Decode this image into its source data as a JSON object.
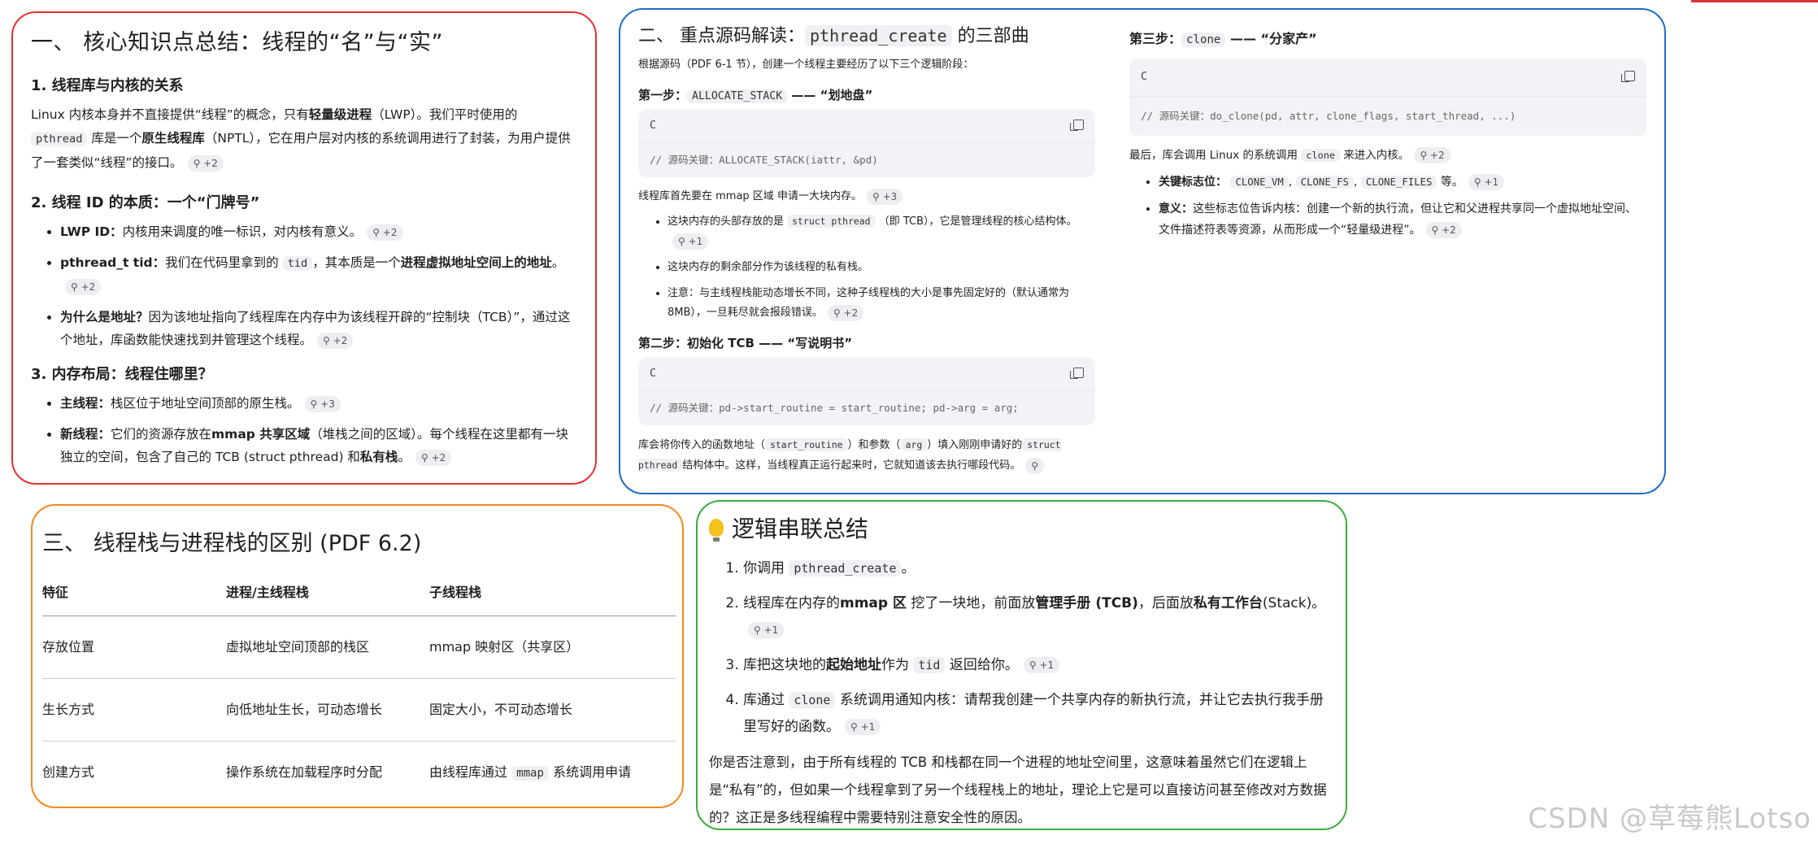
{
  "sec1": {
    "title": "一、 核心知识点总结：线程的“名”与“实”",
    "s1_title": "1. 线程库与内核的关系",
    "s1_p1": "Linux 内核本身并不直接提供“线程”的概念，只有",
    "s1_b1": "轻量级进程",
    "s1_p2": "（LWP）。我们平时使用的",
    "s1_code": "pthread",
    "s1_p3": "库是一个",
    "s1_b2": "原生线程库",
    "s1_p4": "（NPTL），它在用户层对内核的系统调用进行了封装，为用户提供了一套类似“线程”的接口。",
    "s1_cite": "+2",
    "s2_title": "2. 线程 ID 的本质：一个“门牌号”",
    "s2_i1_b": "LWP ID：",
    "s2_i1_t": "内核用来调度的唯一标识，对内核有意义。",
    "s2_i1_c": "+2",
    "s2_i2_b": "pthread_t tid：",
    "s2_i2_t1": "我们在代码里拿到的",
    "s2_i2_code": "tid",
    "s2_i2_t2": "，其本质是一个",
    "s2_i2_b2": "进程虚拟地址空间上的地址",
    "s2_i2_t3": "。",
    "s2_i2_c": "+2",
    "s2_i3_b": "为什么是地址？",
    "s2_i3_t": "因为该地址指向了线程库在内存中为该线程开辟的“控制块（TCB）”，通过这个地址，库函数能快速找到并管理这个线程。",
    "s2_i3_c": "+2",
    "s3_title": "3. 内存布局：线程住哪里？",
    "s3_i1_b": "主线程：",
    "s3_i1_t": "栈区位于地址空间顶部的原生栈。",
    "s3_i1_c": "+3",
    "s3_i2_b": "新线程：",
    "s3_i2_t1": "它们的资源存放在",
    "s3_i2_b2": "mmap 共享区域",
    "s3_i2_t2": "（堆栈之间的区域）。每个线程在这里都有一块独立的空间，包含了自己的 TCB (struct pthread) 和",
    "s3_i2_b3": "私有栈",
    "s3_i2_t3": "。",
    "s3_i2_c": "+2"
  },
  "sec2": {
    "title_pre": "二、 重点源码解读：",
    "title_code": "pthread_create",
    "title_post": "的三部曲",
    "intro": "根据源码（PDF 6-1 节），创建一个线程主要经历了以下三个逻辑阶段：",
    "step1_pre": "第一步：",
    "step1_code": "ALLOCATE_STACK",
    "step1_post": "—— “划地盘”",
    "code_lang": "C",
    "step1_codeline": "// 源码关键：ALLOCATE_STACK(iattr, &pd)",
    "step1_p": "线程库首先要在 mmap 区域 申请一大块内存。",
    "step1_p_c": "+3",
    "step1_i1_t1": "这块内存的头部存放的是",
    "step1_i1_code": "struct pthread",
    "step1_i1_t2": "（即 TCB），它是管理线程的核心结构体。",
    "step1_i1_c": "+1",
    "step1_i2": "这块内存的剩余部分作为该线程的私有栈。",
    "step1_i3": "注意：与主线程栈能动态增长不同，这种子线程栈的大小是事先固定好的（默认通常为 8MB），一旦耗尽就会报段错误。",
    "step1_i3_c": "+2",
    "step2_title": "第二步：初始化 TCB —— “写说明书”",
    "step2_codeline": "// 源码关键：pd->start_routine = start_routine; pd->arg = arg;",
    "step2_p1": "库会将你传入的函数地址（",
    "step2_code1": "start_routine",
    "step2_p2": "）和参数（",
    "step2_code2": "arg",
    "step2_p3": "）填入刚刚申请好的",
    "step2_code3": "struct pthread",
    "step2_p4": "结构体中。这样，当线程真正运行起来时，它就知道该去执行哪段代码。",
    "step3_pre": "第三步：",
    "step3_code": "clone",
    "step3_post": "—— “分家产”",
    "step3_codeline": "// 源码关键：do_clone(pd, attr, clone_flags, start_thread, ...)",
    "step3_p1": "最后，库会调用 Linux 的系统调用",
    "step3_p2": "来进入内核。",
    "step3_c": "+2",
    "step3_i1_b": "关键标志位：",
    "step3_i1_c1": "CLONE_VM",
    "step3_i1_c2": "CLONE_FS",
    "step3_i1_c3": "CLONE_FILES",
    "step3_i1_t": "等。",
    "step3_i1_cite": "+1",
    "step3_i2_b": "意义：",
    "step3_i2_t": "这些标志位告诉内核：创建一个新的执行流，但让它和父进程共享同一个虚拟地址空间、文件描述符表等资源，从而形成一个“轻量级进程”。",
    "step3_i2_c": "+2"
  },
  "sec3": {
    "title": "三、 线程栈与进程栈的区别 (PDF 6.2)",
    "headers": [
      "特征",
      "进程/主线程栈",
      "子线程栈"
    ],
    "rows": [
      [
        "存放位置",
        "虚拟地址空间顶部的栈区",
        "mmap 映射区（共享区）"
      ],
      [
        "生长方式",
        "向低地址生长，可动态增长",
        "固定大小，不可动态增长"
      ],
      [
        "创建方式",
        "操作系统在加载程序时分配",
        ""
      ]
    ],
    "row3_pre": "由线程库通过",
    "row3_code": "mmap",
    "row3_post": "系统调用申请"
  },
  "sec4": {
    "title": "逻辑串联总结",
    "i1_pre": "你调用",
    "i1_code": "pthread_create",
    "i1_post": "。",
    "i2_t1": "线程库在内存的",
    "i2_b1": "mmap 区",
    "i2_t2": "挖了一块地，前面放",
    "i2_b2": "管理手册 (TCB)",
    "i2_t3": "，后面放",
    "i2_b3": "私有工作台",
    "i2_t4": "(Stack)。",
    "i2_c": "+1",
    "i3_t1": "库把这块地的",
    "i3_b": "起始地址",
    "i3_t2": "作为",
    "i3_code": "tid",
    "i3_t3": "返回给你。",
    "i3_c": "+1",
    "i4_t1": "库通过",
    "i4_code": "clone",
    "i4_t2": "系统调用通知内核：请帮我创建一个共享内存的新执行流，并让它去执行我手册里写好的函数。",
    "i4_c": "+1",
    "summary": "你是否注意到，由于所有线程的 TCB 和栈都在同一个进程的地址空间里，这意味着虽然它们在逻辑上是“私有”的，但如果一个线程拿到了另一个线程栈上的地址，理论上它是可以直接访问甚至修改对方数据的？这正是多线程编程中需要特别注意安全性的原因。"
  },
  "watermark": "CSDN @草莓熊Lotso"
}
